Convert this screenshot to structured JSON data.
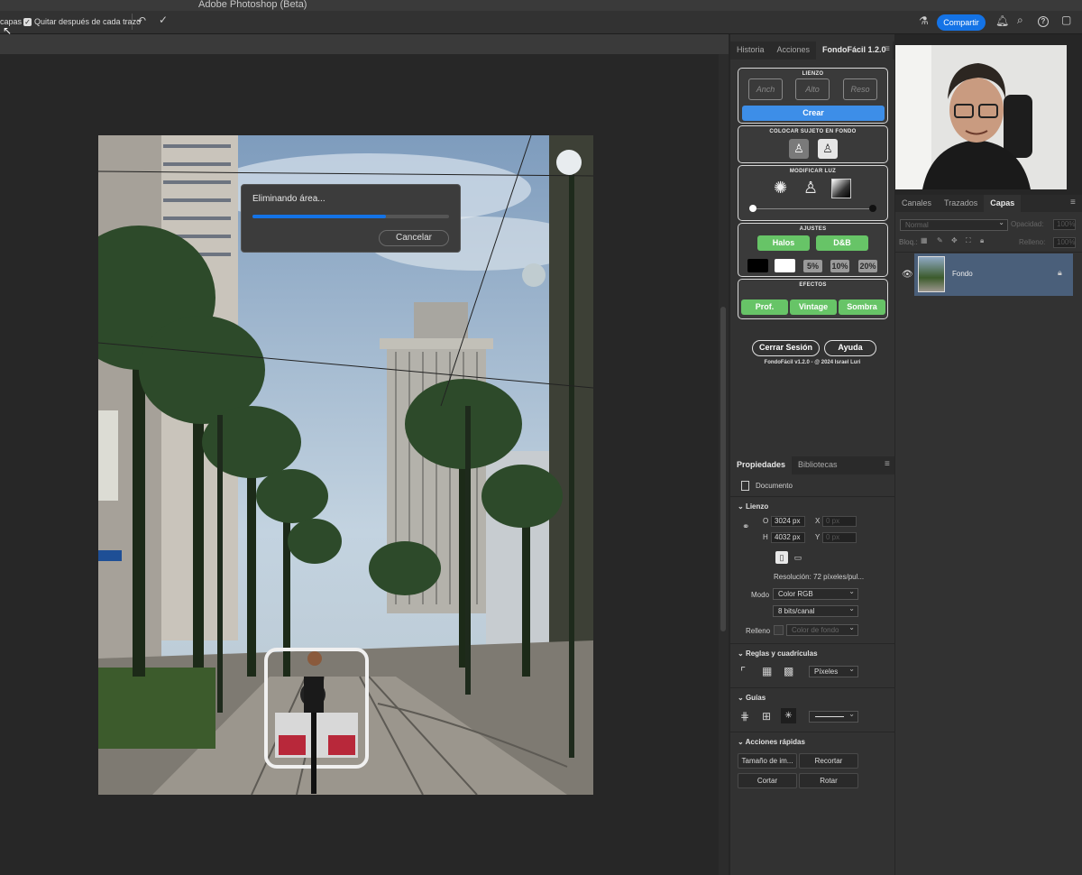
{
  "app": {
    "title": "Adobe Photoshop (Beta)"
  },
  "options_bar": {
    "left_text": "capas",
    "checkbox_label": "Quitar después de cada trazo",
    "share_button": "Compartir"
  },
  "dialog": {
    "title": "Eliminando área...",
    "progress": 0.68,
    "cancel": "Cancelar"
  },
  "plugin_panel": {
    "tabs": [
      "Historia",
      "Acciones",
      "FondoFácil 1.2.0"
    ],
    "active_tab": "FondoFácil 1.2.0",
    "lienzo": {
      "header": "LIENZO",
      "width_ph": "Anch",
      "height_ph": "Alto",
      "res_ph": "Reso",
      "create": "Crear"
    },
    "subject": {
      "header": "COLOCAR SUJETO EN FONDO"
    },
    "light": {
      "header": "MODIFICAR LUZ"
    },
    "adjust": {
      "header": "AJUSTES",
      "halos": "Halos",
      "bw": "D&B",
      "p5": "5%",
      "p10": "10%",
      "p20": "20%"
    },
    "effects": {
      "header": "EFECTOS",
      "prof": "Prof.",
      "vintage": "Vintage",
      "sombra": "Sombra"
    },
    "logout": "Cerrar Sesión",
    "help": "Ayuda",
    "footer": "FondoFácil v1.2.0 - @ 2024 Israel Luri"
  },
  "properties": {
    "tabs": [
      "Propiedades",
      "Bibliotecas"
    ],
    "doc_label": "Documento",
    "canvas_header": "Lienzo",
    "w_label": "O",
    "w_value": "3024 px",
    "h_label": "H",
    "h_value": "4032 px",
    "x_label": "X",
    "x_value": "0 px",
    "y_label": "Y",
    "y_value": "0 px",
    "resolution": "Resolución: 72 píxeles/pul...",
    "mode_label": "Modo",
    "mode_value": "Color RGB",
    "bits_value": "8 bits/canal",
    "fill_label": "Relleno",
    "fill_value": "Color de fondo",
    "rulers_header": "Reglas y cuadrículas",
    "units_value": "Píxeles",
    "guides_header": "Guías",
    "quick_header": "Acciones rápidas",
    "quick_buttons": [
      "Tamaño de im...",
      "Recortar",
      "Cortar",
      "Rotar"
    ]
  },
  "layers": {
    "tabs": [
      "Canales",
      "Trazados",
      "Capas"
    ],
    "active_tab": "Capas",
    "blend_mode": "Normal",
    "opacity_label": "Opacidad:",
    "opacity_value": "100%",
    "lock_label": "Bloq.:",
    "fill_label": "Relleno:",
    "fill_value": "100%",
    "layer_name": "Fondo"
  },
  "colors": {
    "accent": "#1473e6",
    "green": "#67c467",
    "crear": "#3d8ee8",
    "layer_sel": "#4a5f7a"
  }
}
